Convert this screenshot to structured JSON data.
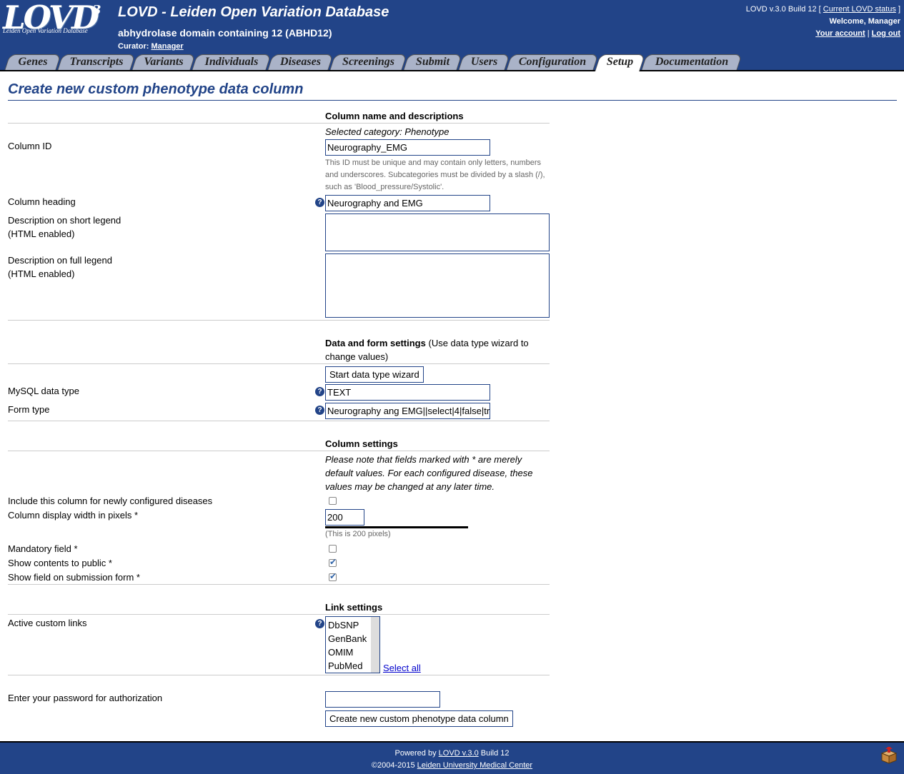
{
  "header": {
    "logo_text": "LOVD",
    "logo_sup": "3",
    "logo_sub": "Leiden Open Variation Database",
    "site_title": "LOVD - Leiden Open Variation Database",
    "gene_title": "abhydrolase domain containing 12 (ABHD12)",
    "curator_label": "Curator:",
    "curator_name": "Manager",
    "version": "LOVD v.3.0 Build 12 [",
    "status_link": "Current LOVD status",
    "version_close": "]",
    "welcome": "Welcome, Manager",
    "account_link": "Your account",
    "separator": "|",
    "logout_link": "Log out"
  },
  "tabs": [
    {
      "label": "Genes"
    },
    {
      "label": "Transcripts"
    },
    {
      "label": "Variants"
    },
    {
      "label": "Individuals"
    },
    {
      "label": "Diseases"
    },
    {
      "label": "Screenings"
    },
    {
      "label": "Submit"
    },
    {
      "label": "Users"
    },
    {
      "label": "Configuration"
    },
    {
      "label": "Setup",
      "active": true
    },
    {
      "label": "Documentation"
    }
  ],
  "page_title": "Create new custom phenotype data column",
  "form": {
    "section1": "Column name and descriptions",
    "selected_category": "Selected category: Phenotype",
    "column_id_label": "Column ID",
    "column_id_value": "Neurography_EMG",
    "column_id_hint": "This ID must be unique and may contain only letters, numbers and underscores. Subcategories must be divided by a slash (/), such as 'Blood_pressure/Systolic'.",
    "heading_label": "Column heading",
    "heading_value": "Neurography and EMG",
    "short_legend_label1": "Description on short legend",
    "short_legend_label2": "(HTML enabled)",
    "full_legend_label1": "Description on full legend",
    "full_legend_label2": "(HTML enabled)",
    "section2": "Data and form settings",
    "section2_note": "(Use data type wizard to change values)",
    "wizard_button": "Start data type wizard",
    "mysql_label": "MySQL data type",
    "mysql_value": "TEXT",
    "formtype_label": "Form type",
    "formtype_value": "Neurography ang EMG||select|4|false|tr",
    "section3": "Column settings",
    "column_note": "Please note that fields marked with * are merely default values. For each configured disease, these values may be changed at any later time.",
    "include_label": "Include this column for newly configured diseases",
    "width_label": "Column display width in pixels *",
    "width_value": "200",
    "width_hint": "(This is 200 pixels)",
    "mandatory_label": "Mandatory field *",
    "public_label": "Show contents to public *",
    "submission_label": "Show field on submission form *",
    "section4": "Link settings",
    "links_label": "Active custom links",
    "links_options": [
      "DbSNP",
      "GenBank",
      "OMIM",
      "PubMed"
    ],
    "select_all": "Select all",
    "password_label": "Enter your password for authorization",
    "submit_button": "Create new custom phenotype data column",
    "help_glyph": "?"
  },
  "footer": {
    "powered_prefix": "Powered by",
    "powered_link": "LOVD v.3.0",
    "powered_suffix": "Build 12",
    "copyright_prefix": "©2004-2015",
    "copyright_link": "Leiden University Medical Center"
  },
  "colors": {
    "header_bg": "#224488",
    "tab_bg": "#aab3c8",
    "border": "#224488"
  }
}
